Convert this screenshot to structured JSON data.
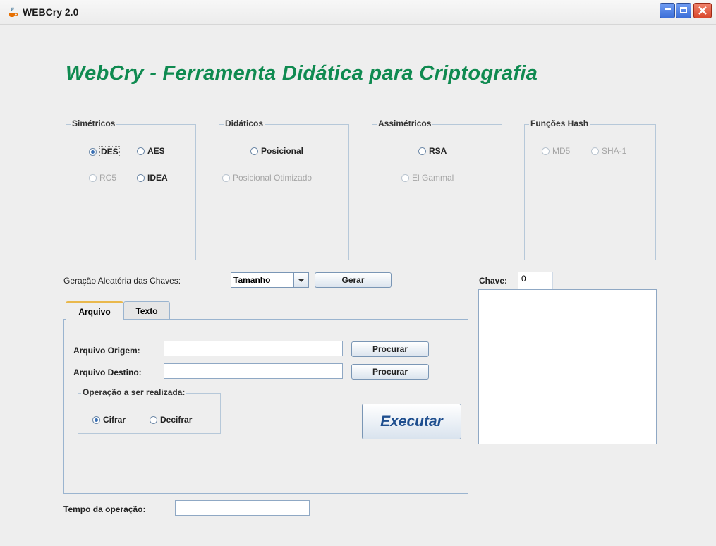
{
  "window": {
    "title": "WEBCry 2.0"
  },
  "heading": "WebCry -  Ferramenta Didática para Criptografia",
  "groups": {
    "simetricos": {
      "title": "Simétricos",
      "options": [
        {
          "label": "DES",
          "checked": true,
          "enabled": true
        },
        {
          "label": "AES",
          "checked": false,
          "enabled": true
        },
        {
          "label": "RC5",
          "checked": false,
          "enabled": false
        },
        {
          "label": "IDEA",
          "checked": false,
          "enabled": true
        }
      ]
    },
    "didaticos": {
      "title": "Didáticos",
      "options": [
        {
          "label": "Posicional",
          "checked": false,
          "enabled": true
        },
        {
          "label": "Posicional Otimizado",
          "checked": false,
          "enabled": false
        }
      ]
    },
    "assimetricos": {
      "title": "Assimétricos",
      "options": [
        {
          "label": "RSA",
          "checked": false,
          "enabled": true
        },
        {
          "label": "El Gammal",
          "checked": false,
          "enabled": false
        }
      ]
    },
    "hash": {
      "title": "Funções Hash",
      "options": [
        {
          "label": "MD5",
          "checked": false,
          "enabled": false
        },
        {
          "label": "SHA-1",
          "checked": false,
          "enabled": false
        }
      ]
    }
  },
  "keygen": {
    "label": "Geração Aleatória das Chaves:",
    "size_selected": "Tamanho",
    "generate_label": "Gerar"
  },
  "key": {
    "label": "Chave:",
    "value": "0"
  },
  "tabs": [
    {
      "label": "Arquivo",
      "active": true
    },
    {
      "label": "Texto",
      "active": false
    }
  ],
  "file_tab": {
    "source_label": "Arquivo Origem:",
    "source_value": "",
    "dest_label": "Arquivo Destino:",
    "dest_value": "",
    "browse_label": "Procurar",
    "operation_title": "Operação a ser realizada:",
    "operations": [
      {
        "label": "Cifrar",
        "checked": true
      },
      {
        "label": "Decifrar",
        "checked": false
      }
    ],
    "execute_label": "Executar"
  },
  "timing": {
    "label": "Tempo da operação:",
    "value": ""
  },
  "colors": {
    "heading": "#0f8a50",
    "execute_text": "#1f4f8f",
    "group_border": "#b6c8d9"
  }
}
